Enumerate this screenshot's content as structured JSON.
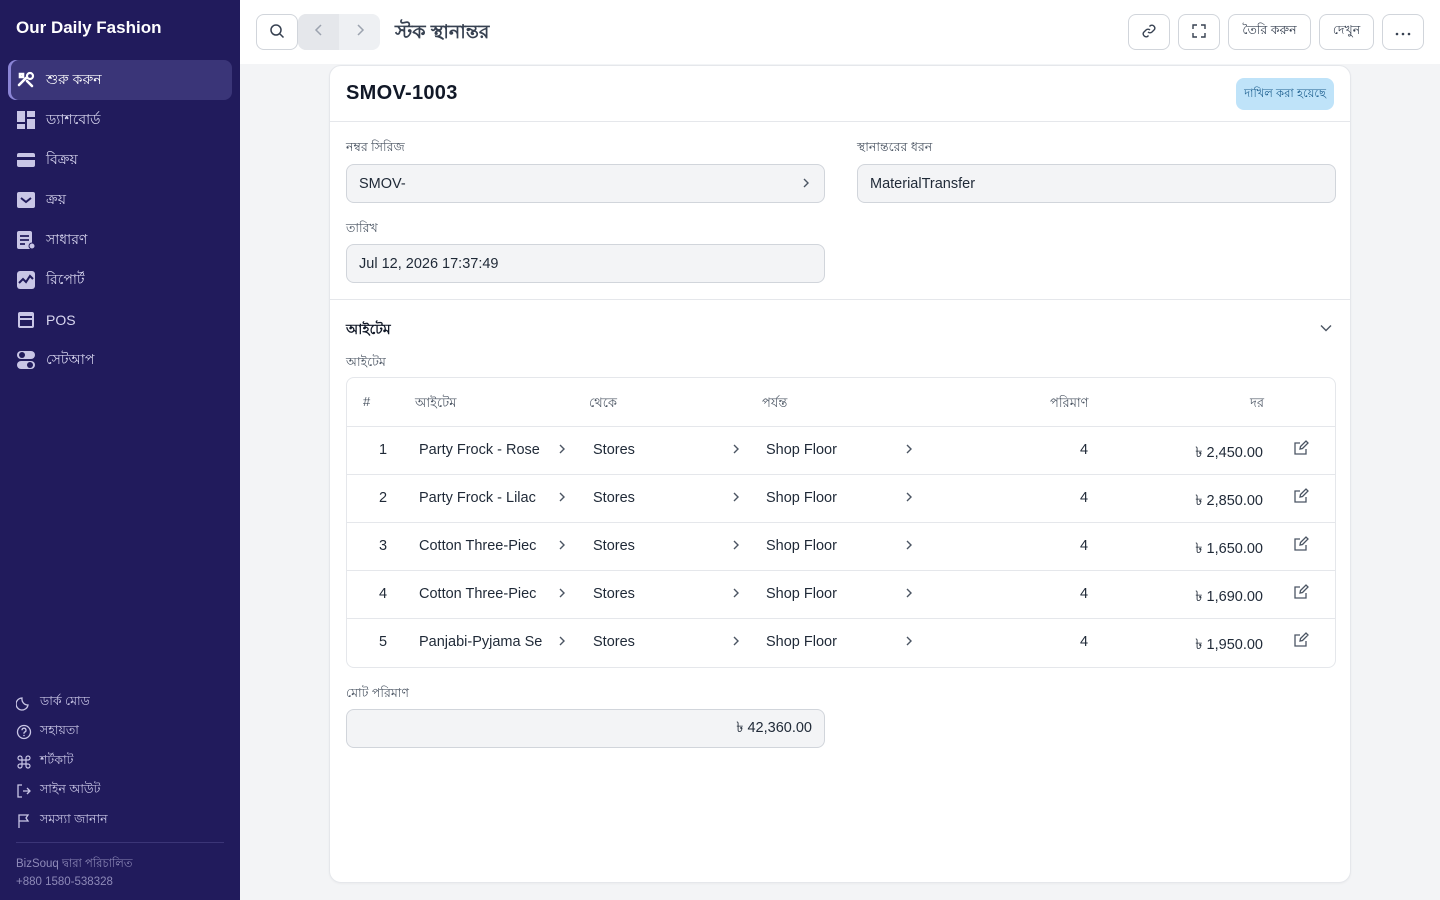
{
  "app": {
    "brand": "Our Daily Fashion"
  },
  "sidebar": {
    "items": [
      {
        "label": "শুরু করুন",
        "icon": "tools-icon",
        "active": true
      },
      {
        "label": "ড্যাশবোর্ড",
        "icon": "dashboard-icon",
        "active": false
      },
      {
        "label": "বিক্রয়",
        "icon": "card-icon",
        "active": false
      },
      {
        "label": "ক্রয়",
        "icon": "inbox-icon",
        "active": false
      },
      {
        "label": "সাধারণ",
        "icon": "ledger-icon",
        "active": false
      },
      {
        "label": "রিপোর্ট",
        "icon": "report-icon",
        "active": false
      },
      {
        "label": "POS",
        "icon": "pos-icon",
        "active": false
      },
      {
        "label": "সেটআপ",
        "icon": "toggle-icon",
        "active": false
      }
    ],
    "bottom": [
      {
        "label": "ডার্ক মোড",
        "icon": "moon-icon"
      },
      {
        "label": "সহায়তা",
        "icon": "help-icon"
      },
      {
        "label": "শর্টকাট",
        "icon": "command-icon"
      },
      {
        "label": "সাইন আউট",
        "icon": "logout-icon"
      },
      {
        "label": "সমস্যা জানান",
        "icon": "flag-icon"
      }
    ],
    "powered_by": "BizSouq দ্বারা পরিচালিত",
    "phone": "+880 1580-538328"
  },
  "topbar": {
    "title": "স্টক স্থানান্তর",
    "create_label": "তৈরি করুন",
    "view_label": "দেখুন"
  },
  "doc": {
    "id": "SMOV-1003",
    "status": "দাখিল করা হয়েছে",
    "naming_series": {
      "label": "নম্বর সিরিজ",
      "value": "SMOV-"
    },
    "transfer_type": {
      "label": "স্থানান্তরের ধরন",
      "value": "MaterialTransfer"
    },
    "date": {
      "label": "তারিখ",
      "value": "Jul 12, 2026 17:37:49"
    }
  },
  "items_section": {
    "title": "আইটেম",
    "table_label": "আইটেম",
    "columns": {
      "idx": "#",
      "item": "আইটেম",
      "from": "থেকে",
      "to": "পর্যন্ত",
      "qty": "পরিমাণ",
      "rate": "দর"
    },
    "rows": [
      {
        "idx": "1",
        "item": "Party Frock - Rose",
        "from": "Stores",
        "to": "Shop Floor",
        "qty": "4",
        "rate": "৳ 2,450.00"
      },
      {
        "idx": "2",
        "item": "Party Frock - Lilac",
        "from": "Stores",
        "to": "Shop Floor",
        "qty": "4",
        "rate": "৳ 2,850.00"
      },
      {
        "idx": "3",
        "item": "Cotton Three-Piec",
        "from": "Stores",
        "to": "Shop Floor",
        "qty": "4",
        "rate": "৳ 1,650.00"
      },
      {
        "idx": "4",
        "item": "Cotton Three-Piec",
        "from": "Stores",
        "to": "Shop Floor",
        "qty": "4",
        "rate": "৳ 1,690.00"
      },
      {
        "idx": "5",
        "item": "Panjabi-Pyjama Se",
        "from": "Stores",
        "to": "Shop Floor",
        "qty": "4",
        "rate": "৳ 1,950.00"
      }
    ]
  },
  "total": {
    "label": "মোট পরিমাণ",
    "value": "৳ 42,360.00"
  },
  "colors": {
    "sidebar_bg": "#211b5c",
    "badge_bg": "#bfe3f9",
    "badge_text": "#1d5f8f"
  }
}
